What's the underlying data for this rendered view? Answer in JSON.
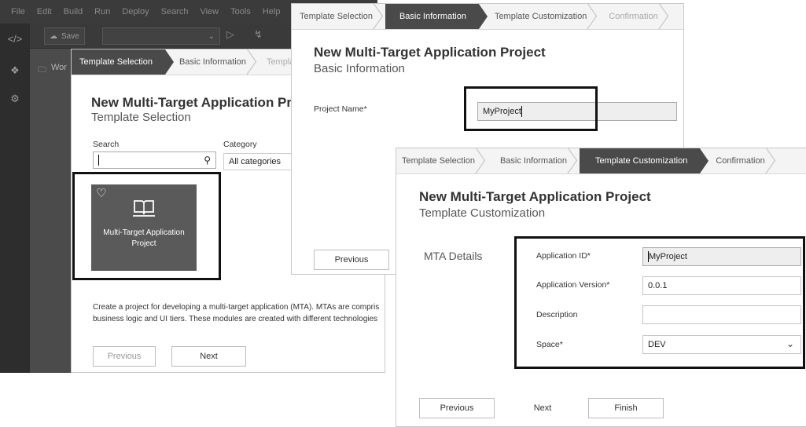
{
  "ide": {
    "menu": [
      "File",
      "Edit",
      "Build",
      "Run",
      "Deploy",
      "Search",
      "View",
      "Tools",
      "Help"
    ],
    "toolbar": {
      "save_label": "Save"
    },
    "workspace_label": "Wor"
  },
  "steps": {
    "template_selection": "Template Selection",
    "basic_information": "Basic Information",
    "template_customization": "Template Customization",
    "confirmation": "Confirmation",
    "d1_truncated_custom": "Template Cu"
  },
  "dialog1": {
    "title": "New Multi-Target Application Pro",
    "subtitle": "Template Selection",
    "search_label": "Search",
    "search_value": "",
    "category_label": "Category",
    "category_value": "All categories",
    "tile_label_line1": "Multi-Target Application",
    "tile_label_line2": "Project",
    "desc_line1": "Create a project for developing a multi-target application (MTA). MTAs are compris",
    "desc_line2": "business logic and UI tiers. These modules are created with different technologies",
    "previous": "Previous",
    "next": "Next"
  },
  "dialog2": {
    "title": "New Multi-Target Application Project",
    "subtitle": "Basic Information",
    "project_name_label": "Project Name*",
    "project_name_value": "MyProject",
    "previous": "Previous"
  },
  "dialog3": {
    "title": "New Multi-Target Application Project",
    "subtitle": "Template Customization",
    "section_label": "MTA Details",
    "app_id_label": "Application ID*",
    "app_id_value": "MyProject",
    "app_version_label": "Application Version*",
    "app_version_value": "0.0.1",
    "description_label": "Description",
    "description_value": "",
    "space_label": "Space*",
    "space_value": "DEV",
    "previous": "Previous",
    "next": "Next",
    "finish": "Finish"
  },
  "icons": {
    "code": "code-icon",
    "settings": "gear-icon",
    "heart": "heart-icon",
    "book": "book-icon",
    "search": "search-icon",
    "folder": "folder-icon",
    "dropdown": "chevron-down-icon"
  },
  "colors": {
    "active_step": "#4a4a4a",
    "tile": "#5a5a5a",
    "ide_bg": "#333333"
  }
}
